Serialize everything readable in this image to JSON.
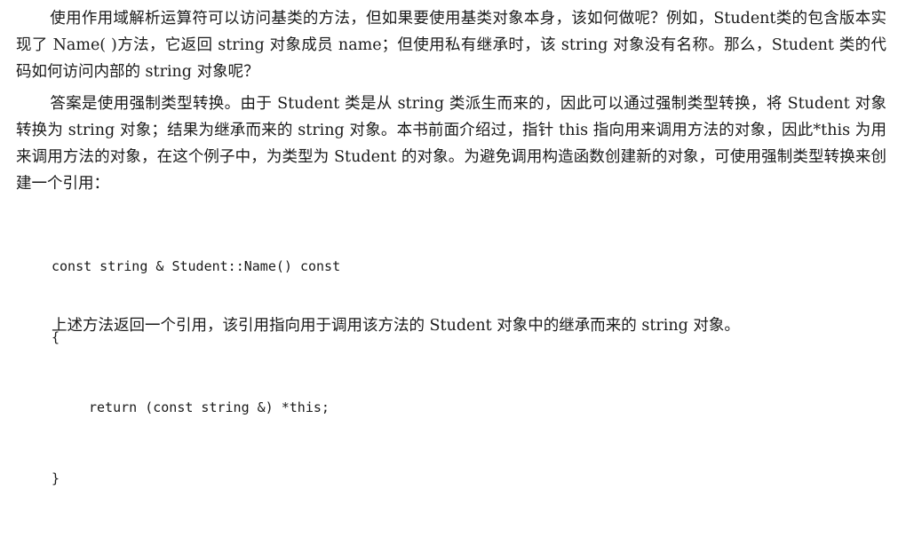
{
  "paragraphs": {
    "p1": "使用作用域解析运算符可以访问基类的方法，但如果要使用基类对象本身，该如何做呢？例如，Student类的包含版本实现了 Name( )方法，它返回 string 对象成员 name；但使用私有继承时，该 string 对象没有名称。那么，Student 类的代码如何访问内部的 string 对象呢？",
    "p2": "答案是使用强制类型转换。由于 Student 类是从 string 类派生而来的，因此可以通过强制类型转换，将 Student 对象转换为 string 对象；结果为继承而来的 string 对象。本书前面介绍过，指针 this 指向用来调用方法的对象，因此*this 为用来调用方法的对象，在这个例子中，为类型为 Student 的对象。为避免调用构造函数创建新的对象，可使用强制类型转换来创建一个引用：",
    "p3": "上述方法返回一个引用，该引用指向用于调用该方法的 Student 对象中的继承而来的 string 对象。"
  },
  "code": {
    "line1": "const string & Student::Name() const",
    "line2": "{",
    "line3": "return (const string &) *this;",
    "line4": "}"
  }
}
